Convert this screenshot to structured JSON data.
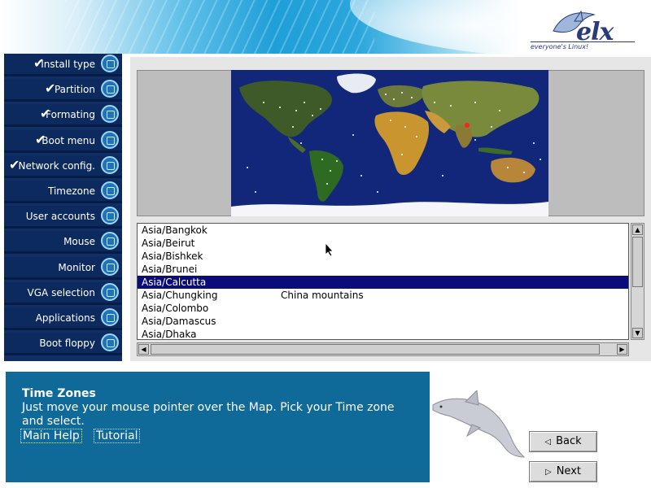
{
  "header": {
    "logo_text": "elx",
    "tagline": "everyone's Linux!"
  },
  "sidebar": {
    "items": [
      {
        "label": "Install type",
        "done": true
      },
      {
        "label": "Partition",
        "done": true
      },
      {
        "label": "Formating",
        "done": true
      },
      {
        "label": "Boot menu",
        "done": true
      },
      {
        "label": "Network config.",
        "done": true
      },
      {
        "label": "Timezone",
        "done": false
      },
      {
        "label": "User accounts",
        "done": false
      },
      {
        "label": "Mouse",
        "done": false
      },
      {
        "label": "Monitor",
        "done": false
      },
      {
        "label": "VGA selection",
        "done": false
      },
      {
        "label": "Applications",
        "done": false
      },
      {
        "label": "Boot floppy",
        "done": false
      }
    ],
    "check_glyph": "✔"
  },
  "timezones": {
    "rows": [
      {
        "zone": "Asia/Bangkok",
        "comment": ""
      },
      {
        "zone": "Asia/Beirut",
        "comment": ""
      },
      {
        "zone": "Asia/Bishkek",
        "comment": ""
      },
      {
        "zone": "Asia/Brunei",
        "comment": ""
      },
      {
        "zone": "Asia/Calcutta",
        "comment": ""
      },
      {
        "zone": "Asia/Chungking",
        "comment": "China mountains"
      },
      {
        "zone": "Asia/Colombo",
        "comment": ""
      },
      {
        "zone": "Asia/Damascus",
        "comment": ""
      },
      {
        "zone": "Asia/Dhaka",
        "comment": ""
      }
    ],
    "selected_index": 4
  },
  "help": {
    "title": "Time Zones",
    "text": "Just move your mouse pointer over the Map. Pick your Time zone and select.",
    "main_help": "Main Help",
    "tutorial": "Tutorial"
  },
  "buttons": {
    "back": "Back",
    "next": "Next"
  },
  "colors": {
    "sidebar_bg": "#0c2a5e",
    "selection": "#0b0b7a",
    "help_bg": "#0f6a9a",
    "ocean": "#12277a"
  }
}
